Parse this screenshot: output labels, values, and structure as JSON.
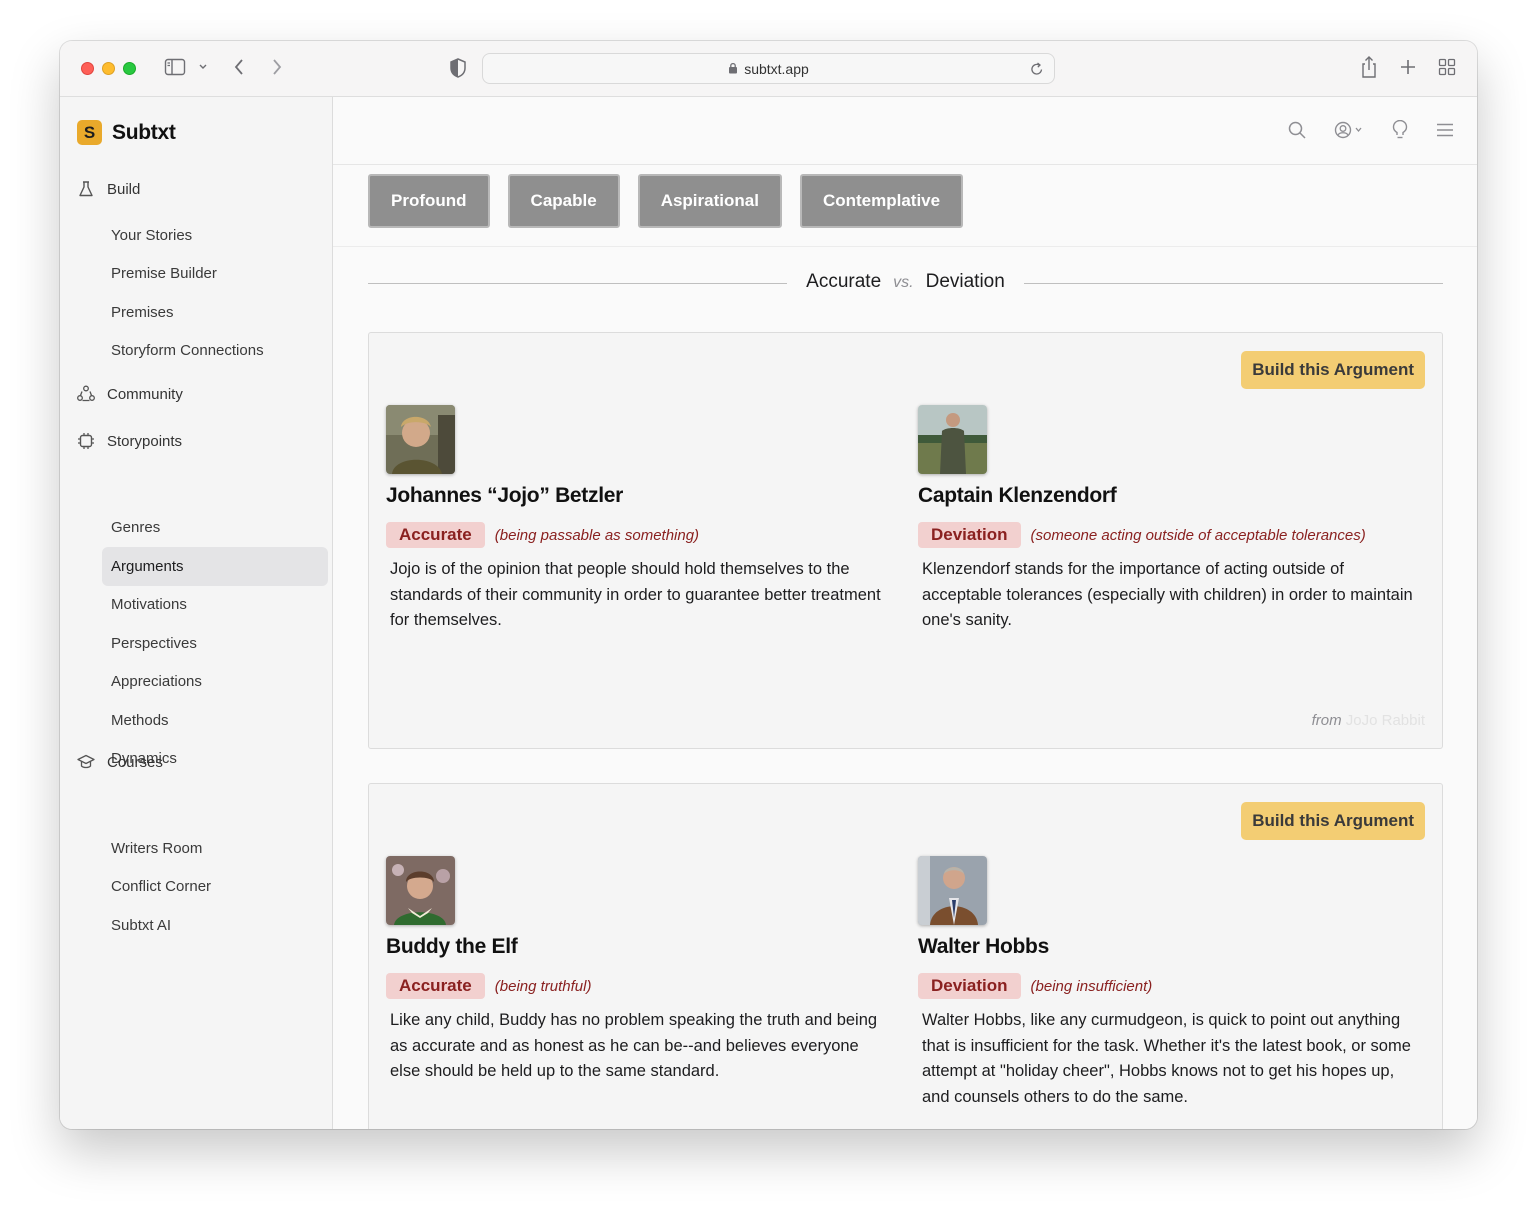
{
  "browser": {
    "url": "subtxt.app"
  },
  "app": {
    "logo_mark": "S",
    "name": "Subtxt"
  },
  "sidebar": {
    "sections": [
      {
        "label": "Build",
        "icon": "flask-icon",
        "items": [
          "Your Stories",
          "Premise Builder",
          "Premises",
          "Storyform Connections"
        ]
      },
      {
        "label": "Community",
        "icon": "community-icon",
        "items": []
      },
      {
        "label": "Storypoints",
        "icon": "storypoints-icon",
        "items": [
          "Genres",
          "Arguments",
          "Motivations",
          "Perspectives",
          "Appreciations",
          "Methods",
          "Dynamics"
        ]
      },
      {
        "label": "Courses",
        "icon": "graduation-cap-icon",
        "items": [
          "Writers Room",
          "Conflict Corner",
          "Subtxt AI"
        ]
      }
    ],
    "active_item": "Arguments"
  },
  "chips": [
    "Profound",
    "Capable",
    "Aspirational",
    "Contemplative"
  ],
  "comparison": {
    "left": "Accurate",
    "vs": "vs.",
    "right": "Deviation"
  },
  "cards": [
    {
      "button": "Build this Argument",
      "left": {
        "name": "Johannes “Jojo” Betzler",
        "tag": "Accurate",
        "note": "(being passable as something)",
        "desc": "Jojo is of the opinion that people should hold themselves to the standards of their community in order to guarantee better treatment for themselves."
      },
      "right": {
        "name": "Captain Klenzendorf",
        "tag": "Deviation",
        "note": "(someone acting outside of acceptable tolerances)",
        "desc": "Klenzendorf stands for the importance of acting outside of acceptable tolerances (especially with children) in order to maintain one's sanity."
      },
      "from_label": "from",
      "film": "JoJo Rabbit"
    },
    {
      "button": "Build this Argument",
      "left": {
        "name": "Buddy the Elf",
        "tag": "Accurate",
        "note": "(being truthful)",
        "desc": "Like any child, Buddy has no problem speaking the truth and being as accurate and as honest as he can be--and believes everyone else should be held up to the same standard."
      },
      "right": {
        "name": "Walter Hobbs",
        "tag": "Deviation",
        "note": "(being insufficient)",
        "desc": "Walter Hobbs, like any curmudgeon, is quick to point out anything that is insufficient for the task. Whether it's the latest book, or some attempt at \"holiday cheer\", Hobbs knows not to get his hopes up, and counsels others to do the same."
      }
    }
  ],
  "colors": {
    "accent_button": "#f3cd73",
    "tag_bg": "#f2d0cf",
    "tag_text": "#8a2120",
    "chip_bg": "#8f8f8f"
  }
}
